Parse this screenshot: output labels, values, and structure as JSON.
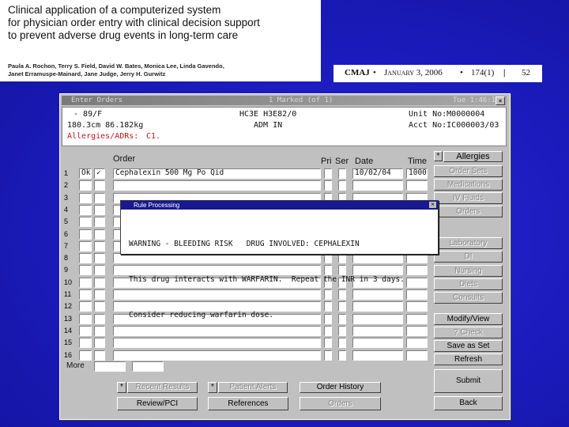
{
  "paper": {
    "title_line1": "Clinical application of a computerized system",
    "title_line2": "for physician order entry with clinical decision support",
    "title_line3": "to prevent adverse drug events in long-term care",
    "authors_line1": "Paula A. Rochon, Terry S. Field, David W. Bates, Monica Lee, Linda Gavendo,",
    "authors_line2": "Janet Erramuspe-Mainard, Jane Judge, Jerry H. Gurwitz",
    "journal": "CMAJ",
    "date": "January 3, 2006",
    "volume": "174(1)",
    "page": "52"
  },
  "window": {
    "title": "Enter Orders",
    "marked": "1 Marked (of 1)",
    "datetime": "Tue 1:46:10",
    "close": "×"
  },
  "patient": {
    "line1": "- 89/F",
    "line1_mid": "HC3E H3E82/0",
    "line1_right": "Unit No:M0000004",
    "line2": "180.3cm 86.182kg",
    "line2_mid": "ADM IN",
    "line2_right": "Acct No:IC000003/03",
    "allergies_label": "Allergies/ADRs:",
    "allergies_value": "C1."
  },
  "grid": {
    "order_header": "Order",
    "pri_header": "Pri",
    "ser_header": "Ser",
    "date_header": "Date",
    "time_header": "Time",
    "more_label": "More",
    "rows": [
      {
        "num": "1",
        "ok": "Ok",
        "check": "✓",
        "order": "Cephalexin 500 Mg Po Qid",
        "date": "10/02/04",
        "time": "1000"
      },
      {
        "num": "2"
      },
      {
        "num": "3"
      },
      {
        "num": "4"
      },
      {
        "num": "5"
      },
      {
        "num": "6"
      },
      {
        "num": "7"
      },
      {
        "num": "8"
      },
      {
        "num": "9"
      },
      {
        "num": "10"
      },
      {
        "num": "11"
      },
      {
        "num": "12"
      },
      {
        "num": "13"
      },
      {
        "num": "14"
      },
      {
        "num": "15"
      },
      {
        "num": "16"
      }
    ]
  },
  "right_buttons": {
    "star": "*",
    "allergies": "Allergies",
    "order_sets": "Order Sets",
    "medications": "Medications",
    "iv_fluids": "IV Fluids",
    "orders": "Orders",
    "laboratory": "Laboratory",
    "di": "DI",
    "nursing": "Nursing",
    "diets": "Diets",
    "consults": "Consults",
    "modify_view": "Modify/View",
    "check": "? Check",
    "save_as_set": "Save as Set",
    "refresh": "Refresh",
    "submit": "Submit",
    "back": "Back"
  },
  "bottom_buttons": {
    "star": "*",
    "recent_results": "Recent Results",
    "patient_alerts": "Patient Alerts",
    "order_history": "Order History",
    "review_pci": "Review/PCI",
    "references": "References",
    "orders": "Orders"
  },
  "dialog": {
    "title": "Rule Processing",
    "close": "×",
    "line1": "WARNING - BLEEDING RISK   DRUG INVOLVED: CEPHALEXIN",
    "line2": "This drug interacts with WARFARIN.  Repeat the INR in 3 days.",
    "line3": "Consider reducing warfarin dose."
  }
}
